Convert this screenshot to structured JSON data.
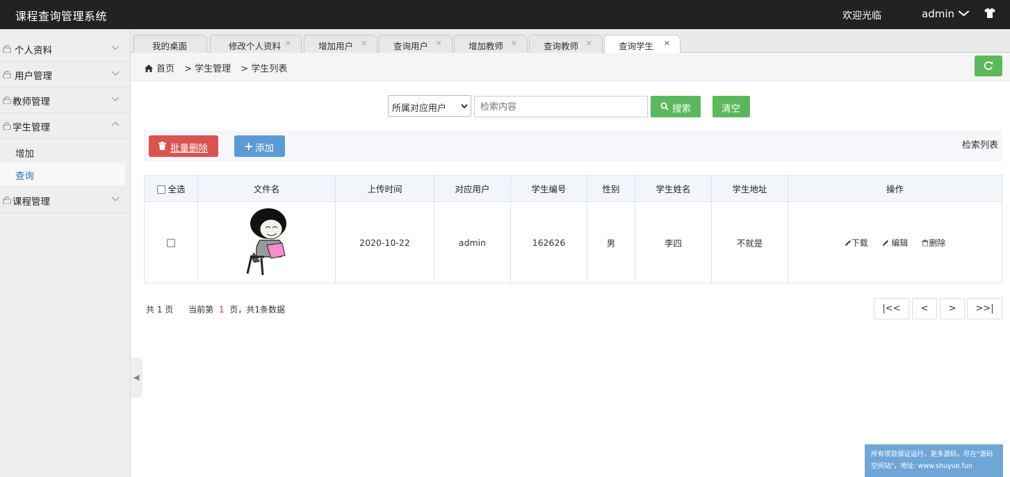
{
  "header": {
    "title": "课程查询管理系统",
    "welcome": "欢迎光临",
    "username": "admin"
  },
  "sidebar": {
    "items": [
      {
        "label": "个人资料"
      },
      {
        "label": "用户管理"
      },
      {
        "label": "教师管理"
      },
      {
        "label": "学生管理",
        "expanded": true,
        "sub": [
          {
            "label": "增加"
          },
          {
            "label": "查询",
            "active": true
          }
        ]
      },
      {
        "label": "课程管理"
      }
    ]
  },
  "tabs": [
    {
      "label": "我的桌面"
    },
    {
      "label": "修改个人资料"
    },
    {
      "label": "增加用户"
    },
    {
      "label": "查询用户"
    },
    {
      "label": "增加教师"
    },
    {
      "label": "查询教师"
    },
    {
      "label": "查询学生",
      "active": true
    }
  ],
  "breadcrumb": {
    "home": "首页",
    "level1": "> 学生管理",
    "level2": "> 学生列表"
  },
  "search": {
    "select_value": "所属对应用户",
    "placeholder": "检索内容",
    "search_label": "搜索",
    "clear_label": "清空"
  },
  "actions": {
    "batch_delete": "批量删除",
    "add": "添加",
    "list_title": "检索列表"
  },
  "table": {
    "headers": [
      "全选",
      "文件名",
      "上传时间",
      "对应用户",
      "学生编号",
      "性别",
      "学生姓名",
      "学生地址",
      "操作"
    ],
    "rows": [
      {
        "upload_time": "2020-10-22",
        "user": "admin",
        "student_no": "162626",
        "gender": "男",
        "name": "李四",
        "address": "不就是",
        "op_download": "下载",
        "op_edit": "编辑",
        "op_delete": "删除"
      }
    ]
  },
  "pagination": {
    "total_pages": "共 1 页",
    "current_prefix": "当前第",
    "current_page": "1",
    "current_suffix": "页，共1条数据",
    "first": "|<<",
    "prev": "<",
    "next": ">",
    "last": ">>|"
  },
  "ad": {
    "line1": "所有项目保证运行，更多源码，尽在\"源码",
    "line2": "空间站\"，地址: www.shuyue.fun"
  },
  "colors": {
    "header_bg": "#222222",
    "success": "#5cb85c",
    "danger": "#d9534f",
    "primary": "#5b9bd5",
    "link_active": "#2a7ab8"
  }
}
